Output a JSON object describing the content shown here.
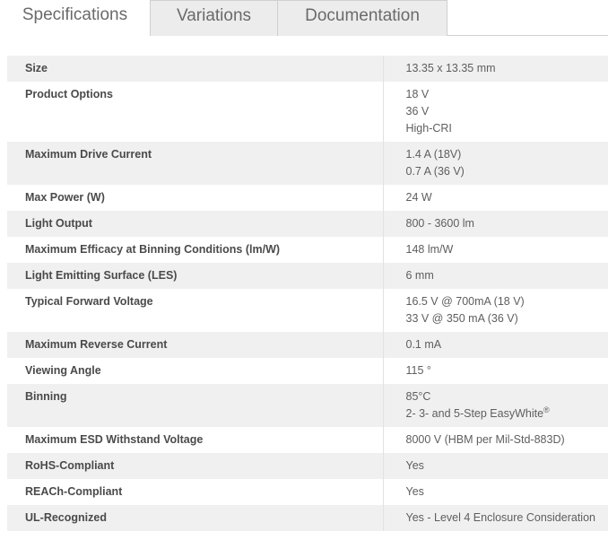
{
  "tabs": {
    "specifications": "Specifications",
    "variations": "Variations",
    "documentation": "Documentation"
  },
  "specs": [
    {
      "label": "Size",
      "values": [
        "13.35 x 13.35 mm"
      ]
    },
    {
      "label": "Product Options",
      "values": [
        "18 V",
        "36 V",
        "High-CRI"
      ]
    },
    {
      "label": "Maximum Drive Current",
      "values": [
        "1.4 A (18V)",
        "0.7 A (36 V)"
      ]
    },
    {
      "label": "Max Power (W)",
      "values": [
        "24 W"
      ]
    },
    {
      "label": "Light Output",
      "values": [
        "800 - 3600 lm"
      ]
    },
    {
      "label": "Maximum Efficacy at Binning Conditions (lm/W)",
      "values": [
        "148 lm/W"
      ]
    },
    {
      "label": "Light Emitting Surface (LES)",
      "values": [
        "6 mm"
      ]
    },
    {
      "label": "Typical Forward Voltage",
      "values": [
        "16.5 V @ 700mA (18 V)",
        "33 V @ 350 mA (36 V)"
      ]
    },
    {
      "label": "Maximum Reverse Current",
      "values": [
        "0.1 mA"
      ]
    },
    {
      "label": "Viewing Angle",
      "values": [
        "115 °"
      ]
    },
    {
      "label": "Binning",
      "values": [
        "85°C",
        "2- 3- and 5-Step EasyWhite"
      ],
      "value_sup": "®"
    },
    {
      "label": "Maximum ESD Withstand Voltage",
      "values": [
        "8000 V (HBM per Mil-Std-883D)"
      ]
    },
    {
      "label": "RoHS-Compliant",
      "values": [
        "Yes"
      ]
    },
    {
      "label": "REACh-Compliant",
      "values": [
        "Yes"
      ]
    },
    {
      "label": "UL-Recognized",
      "values": [
        "Yes - Level 4 Enclosure Consideration"
      ]
    }
  ]
}
